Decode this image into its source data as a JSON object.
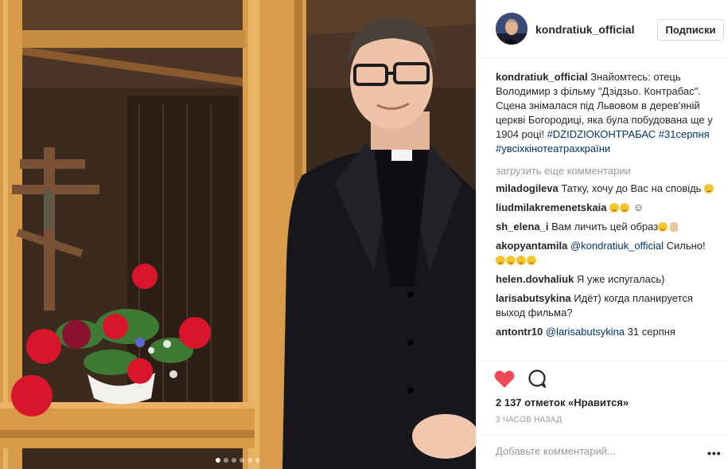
{
  "post": {
    "username": "kondratiuk_official",
    "follow_label": "Подписки",
    "caption_text": "Знайомтесь: отець Володимир з фільму \"Дзідзьо. Контрабас\". Сцена знімалася під Львовом в дерев'яній церкві Богородиці, яка була побудована ще у 1904 році!",
    "caption_tags": [
      "#DZIDZIOКОНТРАБАС",
      "#31серпня",
      "#увсіхкінотеатрахкраїни"
    ],
    "load_more_label": "загрузить еще комментарии",
    "comments": [
      {
        "user": "miladogileva",
        "text": "Татку, хочу до Вас на сповідь",
        "emoji": 1
      },
      {
        "user": "liudmilakremenetskaia",
        "text": "",
        "emoji": 2,
        "symbol": "☺"
      },
      {
        "user": "sh_elena_i",
        "text": "Вам личить цей образ",
        "emoji": 1,
        "hand": true
      },
      {
        "user": "akopyantamila",
        "mention": "@kondratiuk_official",
        "text": "Сильно!",
        "emoji": 4
      },
      {
        "user": "helen.dovhaliuk",
        "text": "Я уже испугалась)"
      },
      {
        "user": "larisabutsykina",
        "text": "Идёт) когда планируется выход фильма?"
      },
      {
        "user": "antontr10",
        "mention": "@larisabutsykina",
        "text": "31 серпня"
      }
    ],
    "likes_text": "2 137 отметок «Нравится»",
    "time_text": "3 ЧАСОВ НАЗАД",
    "add_comment_placeholder": "Добавьте комментарий...",
    "more_options": "•••",
    "carousel": {
      "count": 6,
      "active": 0
    }
  },
  "icons": {
    "like": "heart-icon",
    "comment": "comment-bubble-icon",
    "options": "more-options-icon"
  },
  "colors": {
    "like": "#ed4956",
    "link": "#003569",
    "muted": "#999999",
    "border": "#efefef"
  }
}
